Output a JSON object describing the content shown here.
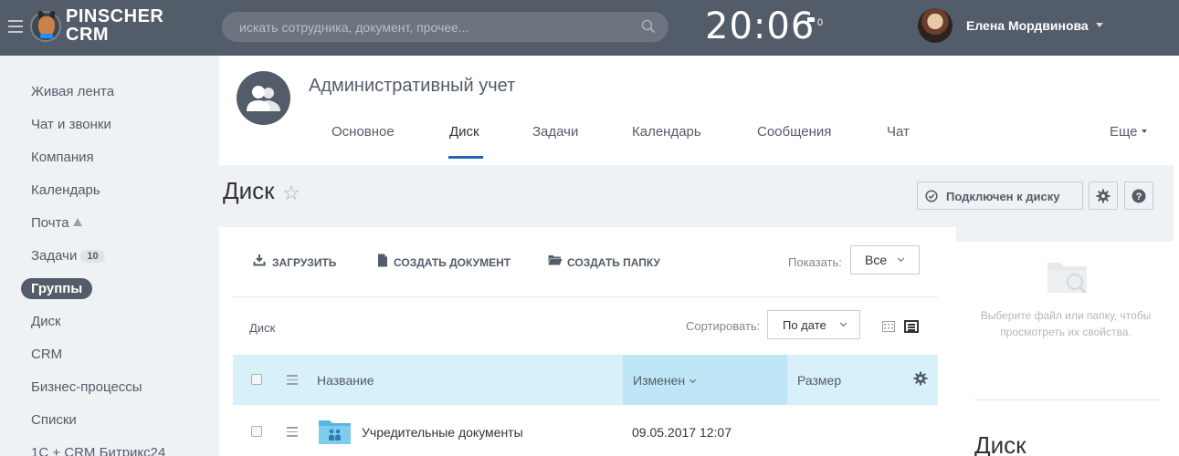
{
  "topbar": {
    "logo_line1": "PINSCHER",
    "logo_line2": "CRM",
    "search_placeholder": "искать сотрудника, документ, прочее...",
    "clock": "20:06",
    "flag_count": "0",
    "user_name": "Елена Мордвинова",
    "bg_color": "#535c69"
  },
  "sidebar": {
    "items": [
      {
        "label": "Живая лента"
      },
      {
        "label": "Чат и звонки"
      },
      {
        "label": "Компания"
      },
      {
        "label": "Календарь"
      },
      {
        "label": "Почта"
      },
      {
        "label": "Задачи",
        "badge": "10"
      },
      {
        "label": "Группы",
        "active": true
      },
      {
        "label": "Диск"
      },
      {
        "label": "CRM"
      },
      {
        "label": "Бизнес-процессы"
      },
      {
        "label": "Списки"
      },
      {
        "label": "1С + CRM Битрикс24"
      }
    ]
  },
  "group": {
    "title": "Административный учет",
    "tabs": [
      {
        "label": "Основное"
      },
      {
        "label": "Диск",
        "active": true
      },
      {
        "label": "Задачи"
      },
      {
        "label": "Календарь"
      },
      {
        "label": "Сообщения"
      },
      {
        "label": "Чат"
      }
    ],
    "more_label": "Еще",
    "active_color": "#2067b0"
  },
  "page": {
    "title": "Диск",
    "connected_label": "Подключен к диску"
  },
  "toolbar": {
    "upload_label": "ЗАГРУЗИТЬ",
    "create_doc_label": "СОЗДАТЬ ДОКУМЕНТ",
    "create_folder_label": "СОЗДАТЬ ПАПКУ",
    "show_label": "Показать:",
    "show_value": "Все"
  },
  "listing": {
    "breadcrumb": "Диск",
    "sort_label": "Сортировать:",
    "sort_value": "По дате",
    "columns": {
      "name": "Название",
      "modified": "Изменен",
      "size": "Размер"
    },
    "rows": [
      {
        "name": "Учредительные документы",
        "modified": "09.05.2017 12:07",
        "size": ""
      }
    ],
    "header_bg": "#d7f0fa",
    "sorted_bg": "#bfe6f6"
  },
  "info_panel": {
    "hint": "Выберите файл или папку, чтобы просмотреть их свойства.",
    "title": "Диск"
  }
}
